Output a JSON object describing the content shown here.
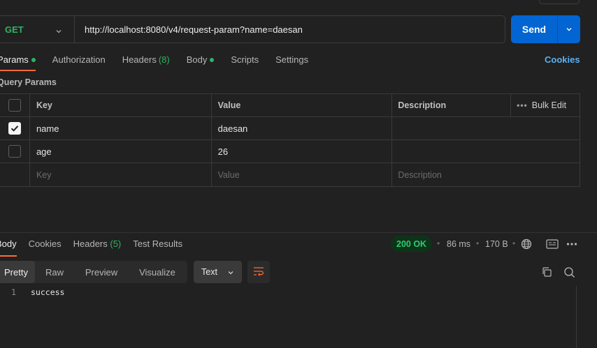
{
  "request": {
    "method": "GET",
    "url": "http://localhost:8080/v4/request-param?name=daesan",
    "send_label": "Send"
  },
  "tabs": [
    {
      "label": "Params",
      "active": true,
      "dot": true
    },
    {
      "label": "Authorization"
    },
    {
      "label": "Headers",
      "count": "(8)"
    },
    {
      "label": "Body",
      "dot": true
    },
    {
      "label": "Scripts"
    },
    {
      "label": "Settings"
    }
  ],
  "cookies_label": "Cookies",
  "query_params": {
    "title": "Query Params",
    "headers": {
      "key": "Key",
      "value": "Value",
      "description": "Description",
      "bulk_edit": "Bulk Edit"
    },
    "rows": [
      {
        "key": "name",
        "value": "daesan",
        "description": "",
        "checked": true
      },
      {
        "key": "age",
        "value": "26",
        "description": "",
        "checked": false
      }
    ],
    "placeholder": {
      "key": "Key",
      "value": "Value",
      "description": "Description"
    }
  },
  "response": {
    "tabs": [
      {
        "label": "Body",
        "active": true
      },
      {
        "label": "Cookies"
      },
      {
        "label": "Headers",
        "count": "(5)"
      },
      {
        "label": "Test Results"
      }
    ],
    "status": "200 OK",
    "time": "86 ms",
    "size": "170 B",
    "view_tabs": [
      "Pretty",
      "Raw",
      "Preview",
      "Visualize"
    ],
    "format": "Text",
    "lines": [
      {
        "num": "1",
        "text": "success"
      }
    ]
  },
  "icons": {
    "globe": "globe-icon",
    "save": "save-example-icon",
    "more": "more-icon",
    "copy": "copy-icon",
    "search": "search-icon",
    "wrap": "wrap-lines-icon"
  },
  "colors": {
    "accent_orange": "#ff6c37",
    "send_blue": "#0265d2",
    "method_green": "#2db460",
    "cookies_link": "#5bb1f4",
    "status_green": "#2ecc71"
  }
}
